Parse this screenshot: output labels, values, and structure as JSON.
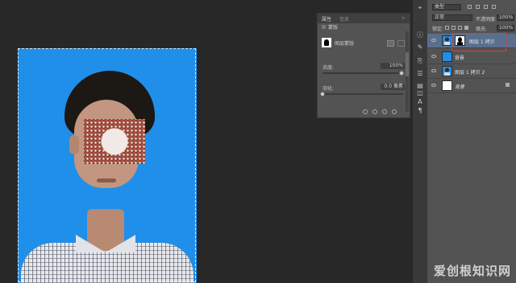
{
  "properties_panel": {
    "tabs": [
      "属性",
      "信息"
    ],
    "collapse_icon": "double-chevron-icon",
    "section": "蒙版",
    "mask_title": "图层蒙版",
    "density_label": "浓度:",
    "density_value": "100%",
    "feather_label": "羽化:",
    "feather_value": "0.0 像素"
  },
  "layers_panel": {
    "filter_kind": "类型",
    "blend_mode": "正常",
    "opacity_label": "不透明度:",
    "opacity_value": "100%",
    "lock_label": "锁定:",
    "fill_label": "填充:",
    "fill_value": "100%",
    "layers": [
      {
        "name": "图层 1 拷贝",
        "selected": true,
        "has_mask": true
      },
      {
        "name": "背景",
        "thumb": "#1f8fea"
      },
      {
        "name": "图层 1 拷贝 2",
        "thumb": "portrait"
      },
      {
        "name": "背景",
        "thumb": "#ffffff",
        "italic": true,
        "locked": true
      }
    ]
  },
  "toolstrip": {
    "icons": [
      "history-icon",
      "info-icon",
      "brush-icon",
      "clone-icon",
      "adjust-icon",
      "layers-icon",
      "channels-icon",
      "character-icon",
      "paragraph-icon"
    ]
  },
  "watermark": "爱创根知识网",
  "colors": {
    "canvas_bg": "#1f8fea",
    "highlight": "#e23b3b",
    "selected_layer": "#5a6f8c"
  }
}
